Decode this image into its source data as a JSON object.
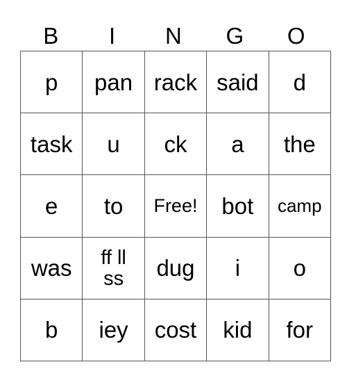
{
  "header": [
    "B",
    "I",
    "N",
    "G",
    "O"
  ],
  "rows": [
    [
      "p",
      "pan",
      "rack",
      "said",
      "d"
    ],
    [
      "task",
      "u",
      "ck",
      "a",
      "the"
    ],
    [
      "e",
      "to",
      "Free!",
      "bot",
      "camp"
    ],
    [
      "was",
      "ff ll\nss",
      "dug",
      "i",
      "o"
    ],
    [
      "b",
      "iey",
      "cost",
      "kid",
      "for"
    ]
  ]
}
